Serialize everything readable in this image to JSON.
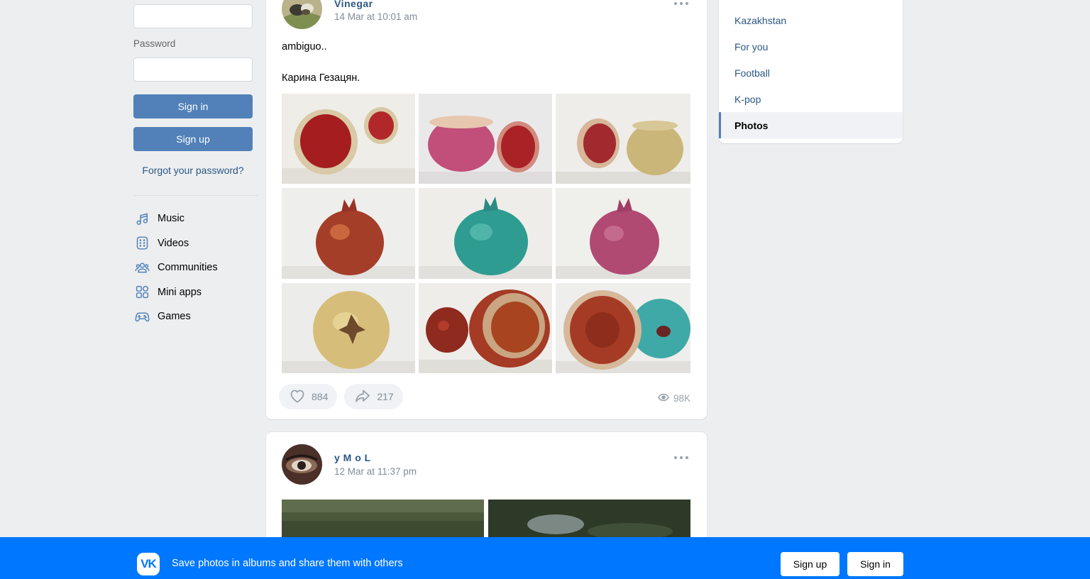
{
  "login": {
    "password_label": "Password",
    "sign_in": "Sign in",
    "sign_up": "Sign up",
    "forgot": "Forgot your password?"
  },
  "nav": [
    {
      "label": "Music",
      "icon": "music-icon"
    },
    {
      "label": "Videos",
      "icon": "video-icon"
    },
    {
      "label": "Communities",
      "icon": "communities-icon"
    },
    {
      "label": "Mini apps",
      "icon": "mini-apps-icon"
    },
    {
      "label": "Games",
      "icon": "gamepad-icon"
    }
  ],
  "posts": [
    {
      "author": "Vinegar",
      "date": "14 Mar at 10:01 am",
      "text_lines": [
        "ambiguo..",
        "Карина Гезацян."
      ],
      "likes": "884",
      "shares": "217",
      "views": "98K"
    },
    {
      "author": "y M o L",
      "date": "12 Mar at 11:37 pm"
    }
  ],
  "right_menu": {
    "items": [
      "Kazakhstan",
      "For you",
      "Football",
      "K-pop",
      "Photos"
    ],
    "active": "Photos"
  },
  "banner": {
    "logo": "VK",
    "text": "Save photos in albums and share them with others",
    "sign_up": "Sign up",
    "sign_in": "Sign in"
  },
  "colors": {
    "accent": "#5181b8",
    "link": "#2a5885",
    "banner": "#0077ff",
    "background": "#edeef0"
  }
}
